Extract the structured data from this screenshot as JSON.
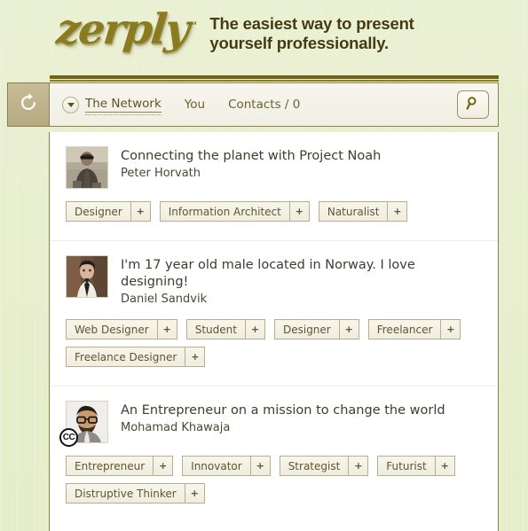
{
  "brand": {
    "logo_text": "zerply",
    "logo_tm": "™",
    "tagline_line1": "The easiest way to present",
    "tagline_line2": "yourself professionally.",
    "logo_color": "#8a7a20",
    "tagline_color": "#453a12"
  },
  "nav": {
    "refresh_icon": "refresh-icon",
    "caret_icon": "chevron-down-icon",
    "items": [
      {
        "label": "The Network",
        "active": true
      },
      {
        "label": "You",
        "active": false
      },
      {
        "label": "Contacts / 0",
        "active": false
      }
    ],
    "search_icon": "search-icon",
    "accent_color": "#6e6415",
    "bar_bg": "#f4f2e6"
  },
  "feed": {
    "entries": [
      {
        "headline": "Connecting the planet with Project Noah",
        "name": "Peter Horvath",
        "avatar": "photo-man-sunglasses",
        "cc_badge": null,
        "tags": [
          {
            "label": "Designer",
            "add": "+"
          },
          {
            "label": "Information Architect",
            "add": "+"
          },
          {
            "label": "Naturalist",
            "add": "+"
          }
        ]
      },
      {
        "headline": "I'm 17 year old male located in Norway. I love designing!",
        "name": "Daniel Sandvik",
        "avatar": "photo-man-tie",
        "cc_badge": null,
        "tags": [
          {
            "label": "Web Designer",
            "add": "+"
          },
          {
            "label": "Student",
            "add": "+"
          },
          {
            "label": "Designer",
            "add": "+"
          },
          {
            "label": "Freelancer",
            "add": "+"
          },
          {
            "label": "Freelance Designer",
            "add": "+"
          }
        ]
      },
      {
        "headline": "An Entrepreneur on a mission to change the world",
        "name": "Mohamad Khawaja",
        "avatar": "photo-man-glasses",
        "cc_badge": "CC",
        "tags": [
          {
            "label": "Entrepreneur",
            "add": "+"
          },
          {
            "label": "Innovator",
            "add": "+"
          },
          {
            "label": "Strategist",
            "add": "+"
          },
          {
            "label": "Futurist",
            "add": "+"
          },
          {
            "label": "Distruptive Thinker",
            "add": "+"
          }
        ]
      }
    ]
  }
}
